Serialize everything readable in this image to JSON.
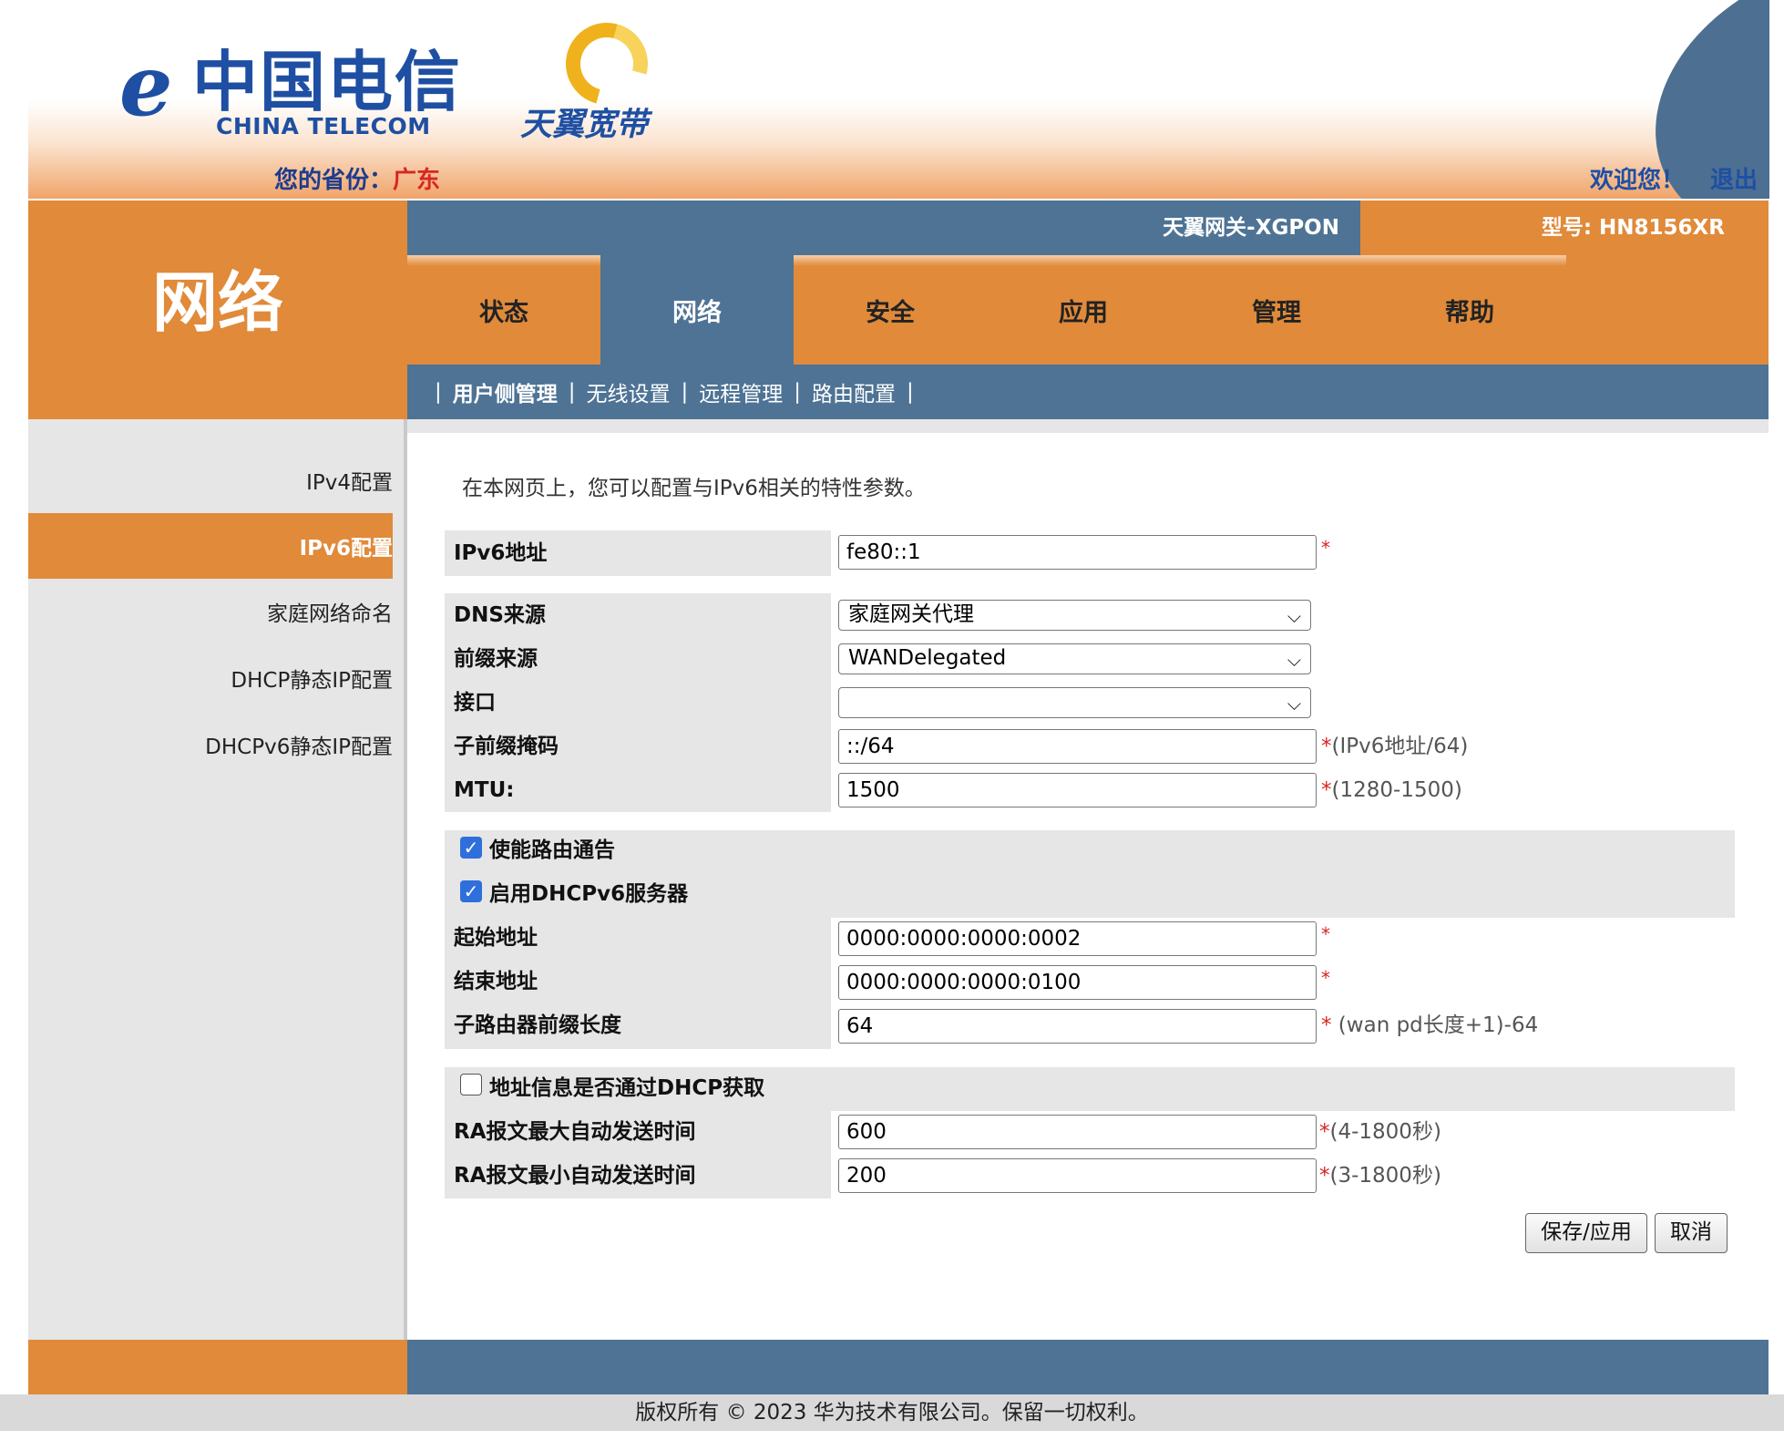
{
  "header": {
    "logo_cn": "中国电信",
    "logo_en": "CHINA TELECOM",
    "logo2_text": "天翼宽带",
    "province_label": "您的省份：",
    "province_value": "广东",
    "welcome": "欢迎您！",
    "logout": "退出"
  },
  "section_title": "网络",
  "topbar": {
    "device_name": "天翼网关-XGPON",
    "model": "型号: HN8156XR"
  },
  "tabs": [
    {
      "label": "状态",
      "active": false
    },
    {
      "label": "网络",
      "active": true
    },
    {
      "label": "安全",
      "active": false
    },
    {
      "label": "应用",
      "active": false
    },
    {
      "label": "管理",
      "active": false
    },
    {
      "label": "帮助",
      "active": false
    }
  ],
  "subnav": {
    "separator": "|",
    "items": [
      "用户侧管理",
      "无线设置",
      "远程管理",
      "路由配置"
    ],
    "active_index": 0
  },
  "sidebar": {
    "items": [
      "IPv4配置",
      "IPv6配置",
      "家庭网络命名",
      "DHCP静态IP配置",
      "DHCPv6静态IP配置"
    ],
    "active_index": 1
  },
  "form": {
    "intro": "在本网页上，您可以配置与IPv6相关的特性参数。",
    "ipv6_address": {
      "label": "IPv6地址",
      "value": "fe80::1"
    },
    "dns_source": {
      "label": "DNS来源",
      "selected": "家庭网关代理"
    },
    "prefix_source": {
      "label": "前缀来源",
      "selected": "WANDelegated"
    },
    "interface": {
      "label": "接口",
      "selected": ""
    },
    "subprefix_mask": {
      "label": "子前缀掩码",
      "value": "::/64",
      "hint": "(IPv6地址/64)"
    },
    "mtu": {
      "label": "MTU:",
      "value": "1500",
      "hint": "(1280-1500)"
    },
    "enable_ra": {
      "label": "使能路由通告",
      "checked": true
    },
    "enable_dhcpv6": {
      "label": "启用DHCPv6服务器",
      "checked": true
    },
    "start_address": {
      "label": "起始地址",
      "value": "0000:0000:0000:0002"
    },
    "end_address": {
      "label": "结束地址",
      "value": "0000:0000:0000:0100"
    },
    "subrouter_prefix_len": {
      "label": "子路由器前缀长度",
      "value": "64",
      "hint": " (wan pd长度+1)-64"
    },
    "addr_via_dhcp": {
      "label": "地址信息是否通过DHCP获取",
      "checked": false
    },
    "ra_max_interval": {
      "label": "RA报文最大自动发送时间",
      "value": "600",
      "hint": "(4-1800秒)"
    },
    "ra_min_interval": {
      "label": "RA报文最小自动发送时间",
      "value": "200",
      "hint": "(3-1800秒)"
    },
    "required_mark": "*",
    "save_button": "保存/应用",
    "cancel_button": "取消"
  },
  "footer": {
    "copyright": "版权所有 © 2023 华为技术有限公司。保留一切权利。"
  },
  "colors": {
    "orange": "#e08a3a",
    "blue": "#4e7395",
    "brand_blue": "#1e4fa3",
    "required_red": "#d8261f"
  }
}
